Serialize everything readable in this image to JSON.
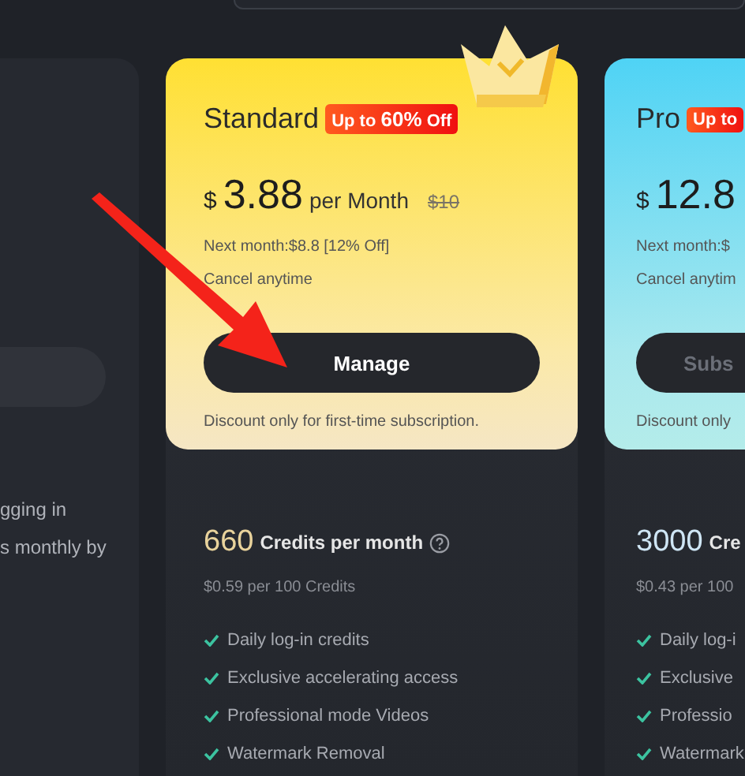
{
  "left_panel": {
    "lines": [
      "gging in",
      "s monthly by"
    ]
  },
  "plans": [
    {
      "color": "#ffe033",
      "selected": true,
      "name": "Standard",
      "badge": "Up to **60%** Off",
      "currency": "$",
      "price": "3.88",
      "period": "per Month",
      "old_price": "$10",
      "next_month": "Next month:$8.8 [12% Off]",
      "cancel": "Cancel anytime",
      "button": "Manage",
      "note": "Discount only for first-time subscription.",
      "credits": "660",
      "credits_label": "Credits per month",
      "help": true,
      "per_credits": "$0.59 per 100 Credits",
      "features": [
        "Daily log-in credits",
        "Exclusive accelerating access",
        "Professional mode Videos",
        "Watermark Removal"
      ]
    },
    {
      "color": "#4fd3f5",
      "selected": false,
      "name": "Pro",
      "badge": "Up to",
      "currency": "$",
      "price": "12.8",
      "next_month": "Next month:$",
      "cancel": "Cancel anytim",
      "button": "Subs",
      "note": "Discount only",
      "credits": "3000",
      "credits_label": "Cre",
      "help": false,
      "per_credits": "$0.43 per 100",
      "features": [
        "Daily log-i",
        "Exclusive",
        "Professio",
        "Watermark"
      ]
    }
  ]
}
